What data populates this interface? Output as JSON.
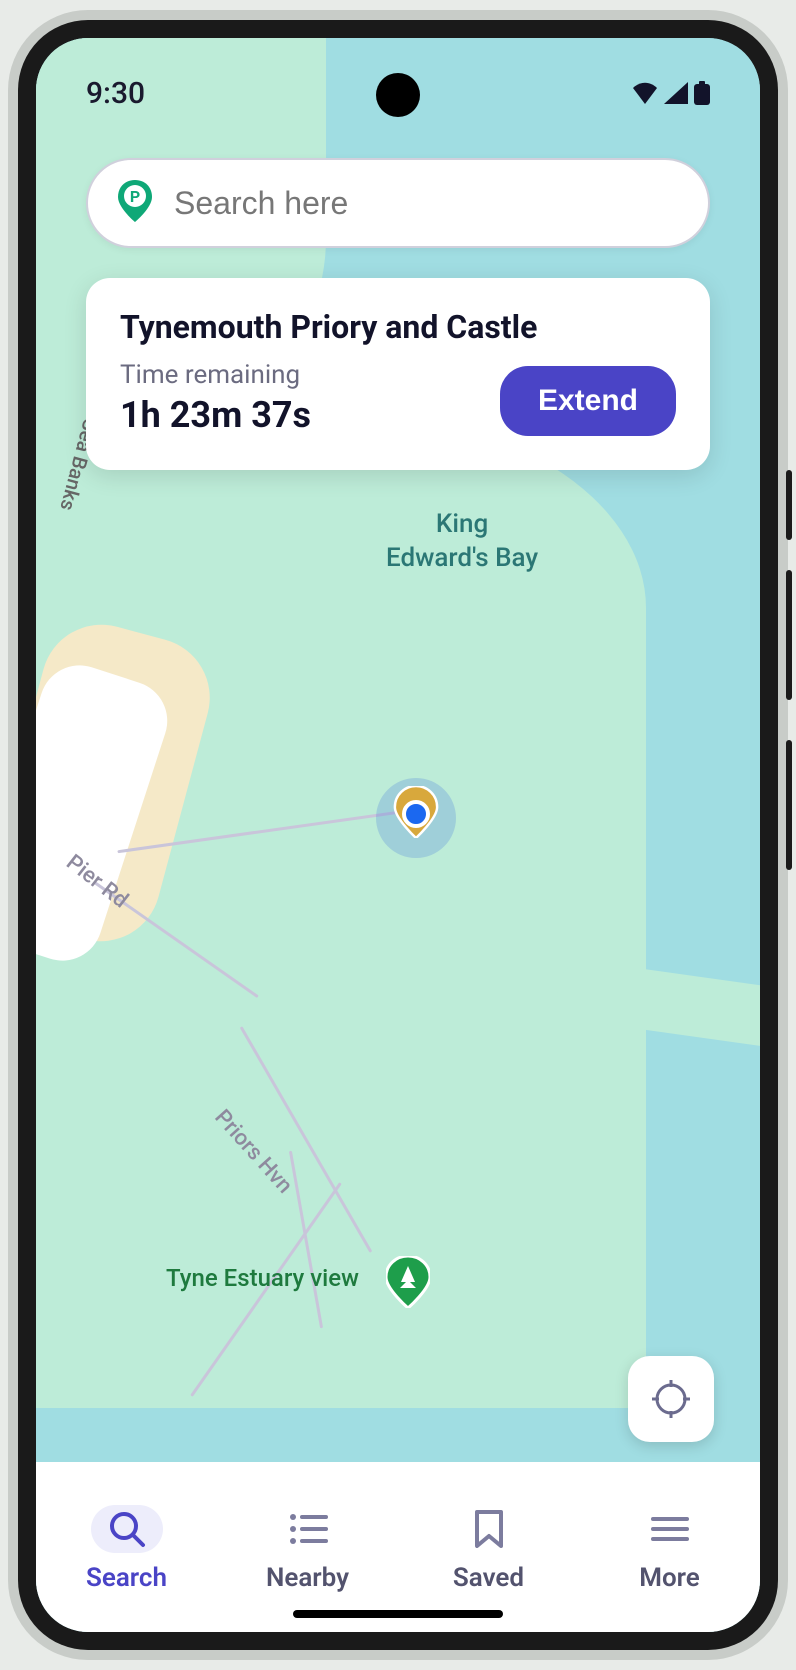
{
  "status": {
    "time": "9:30"
  },
  "search": {
    "placeholder": "Search here"
  },
  "session": {
    "location": "Tynemouth Priory and Castle",
    "sub_label": "Time remaining",
    "time_remaining": "1h 23m 37s",
    "extend_label": "Extend"
  },
  "map_labels": {
    "bay": "King\nEdward's Bay",
    "sea_banks": "Sea Banks",
    "pier_rd": "Pier Rd",
    "priors_hvn": "Priors Hvn",
    "tyne_estuary": "Tyne Estuary view"
  },
  "nav": {
    "items": [
      {
        "key": "search",
        "label": "Search",
        "active": true
      },
      {
        "key": "nearby",
        "label": "Nearby",
        "active": false
      },
      {
        "key": "saved",
        "label": "Saved",
        "active": false
      },
      {
        "key": "more",
        "label": "More",
        "active": false
      }
    ]
  },
  "colors": {
    "primary": "#4A44C6",
    "water": "#A0DDE2",
    "land": "#BDECD8"
  }
}
